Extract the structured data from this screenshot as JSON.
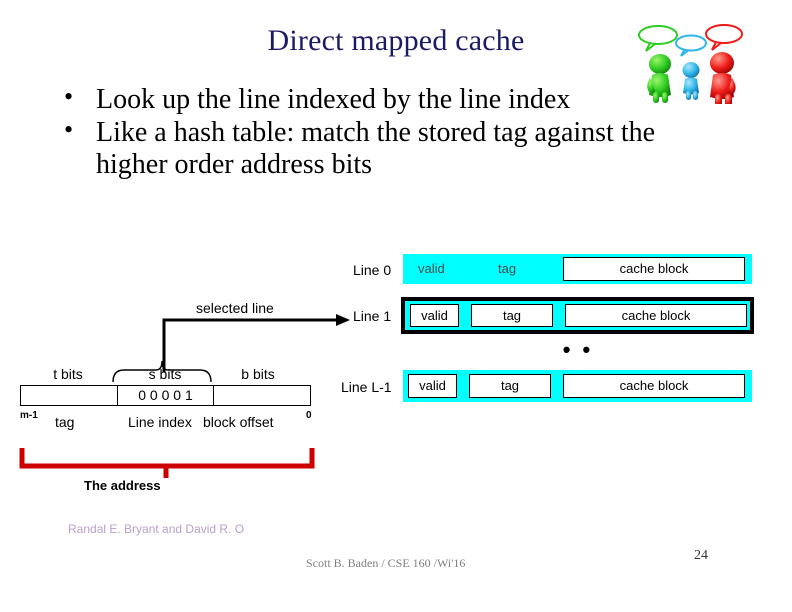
{
  "slide": {
    "title": "Direct mapped cache",
    "bullets": [
      "Look up the line indexed by the line index",
      "Like a hash table: match the stored tag against the higher order address  bits"
    ],
    "bullet_marker": "•"
  },
  "cache": {
    "rows": [
      {
        "label": "Line 0",
        "valid": "valid",
        "tag": "tag",
        "block": "cache block",
        "style": "plain"
      },
      {
        "label": "Line 1",
        "valid": "valid",
        "tag": "tag",
        "block": "cache block",
        "style": "selected"
      },
      {
        "label": "Line L-1",
        "valid": "valid",
        "tag": "tag",
        "block": "cache block",
        "style": "boxed"
      }
    ],
    "ellipsis": "• • •",
    "selected_line_label": "selected line",
    "highlight_color": "#00ffff"
  },
  "address": {
    "top_labels": [
      "t bits",
      "s bits",
      "b bits"
    ],
    "fields": [
      "",
      "0 0  0 0 1",
      ""
    ],
    "bottom_labels": [
      "tag",
      "Line index",
      "block  offset"
    ],
    "left_subscript": "m-1",
    "right_subscript": "0",
    "bracket_label": "The address",
    "bracket_color": "#cc0000"
  },
  "footer": {
    "credit": "Randal E. Bryant and David R. O",
    "course": "Scott B. Baden / CSE 160 /Wi'16",
    "page_number": "24"
  }
}
